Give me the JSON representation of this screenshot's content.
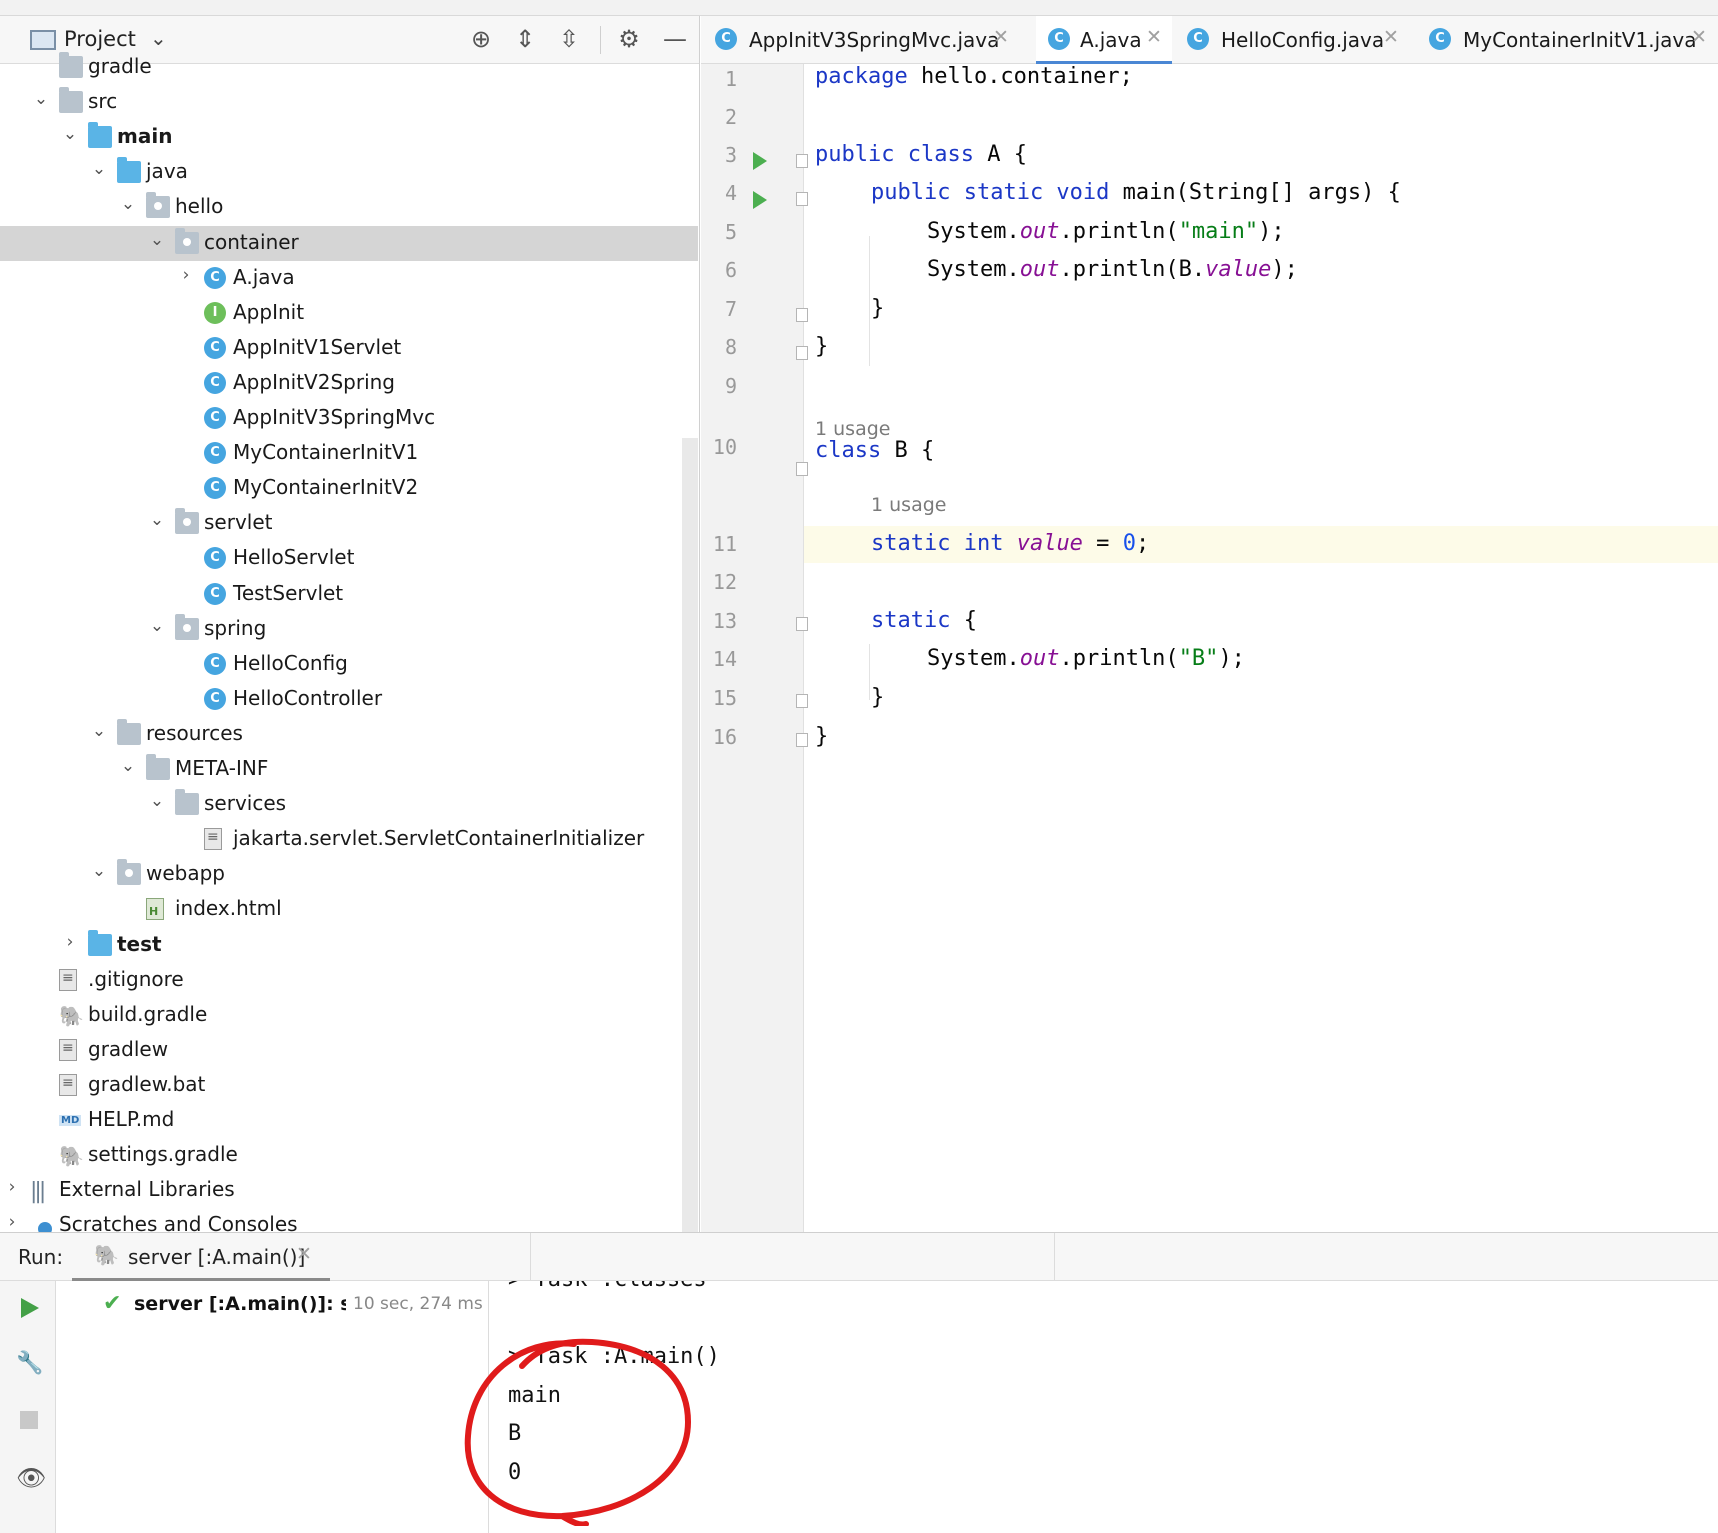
{
  "project_panel": {
    "title": "Project",
    "tree": [
      {
        "label": "gradle",
        "depth": 1,
        "toggle": "",
        "icon": "folder-icon"
      },
      {
        "label": "src",
        "depth": 1,
        "toggle": "expanded",
        "icon": "folder-icon"
      },
      {
        "label": "main",
        "depth": 2,
        "toggle": "expanded",
        "icon": "source-root-folder-icon",
        "bold": true
      },
      {
        "label": "java",
        "depth": 3,
        "toggle": "expanded",
        "icon": "java-source-folder-icon"
      },
      {
        "label": "hello",
        "depth": 4,
        "toggle": "expanded",
        "icon": "package-icon"
      },
      {
        "label": "container",
        "depth": 5,
        "toggle": "expanded",
        "icon": "package-icon",
        "selected": true
      },
      {
        "label": "A.java",
        "depth": 6,
        "toggle": "collapsed",
        "icon": "runnable-class-icon"
      },
      {
        "label": "AppInit",
        "depth": 6,
        "toggle": "",
        "icon": "interface-icon"
      },
      {
        "label": "AppInitV1Servlet",
        "depth": 6,
        "toggle": "",
        "icon": "class-icon"
      },
      {
        "label": "AppInitV2Spring",
        "depth": 6,
        "toggle": "",
        "icon": "class-icon"
      },
      {
        "label": "AppInitV3SpringMvc",
        "depth": 6,
        "toggle": "",
        "icon": "class-icon"
      },
      {
        "label": "MyContainerInitV1",
        "depth": 6,
        "toggle": "",
        "icon": "class-icon"
      },
      {
        "label": "MyContainerInitV2",
        "depth": 6,
        "toggle": "",
        "icon": "class-icon"
      },
      {
        "label": "servlet",
        "depth": 5,
        "toggle": "expanded",
        "icon": "package-icon"
      },
      {
        "label": "HelloServlet",
        "depth": 6,
        "toggle": "",
        "icon": "class-icon"
      },
      {
        "label": "TestServlet",
        "depth": 6,
        "toggle": "",
        "icon": "class-icon"
      },
      {
        "label": "spring",
        "depth": 5,
        "toggle": "expanded",
        "icon": "package-icon"
      },
      {
        "label": "HelloConfig",
        "depth": 6,
        "toggle": "",
        "icon": "class-icon"
      },
      {
        "label": "HelloController",
        "depth": 6,
        "toggle": "",
        "icon": "class-icon"
      },
      {
        "label": "resources",
        "depth": 3,
        "toggle": "expanded",
        "icon": "resources-folder-icon"
      },
      {
        "label": "META-INF",
        "depth": 4,
        "toggle": "expanded",
        "icon": "folder-icon"
      },
      {
        "label": "services",
        "depth": 5,
        "toggle": "expanded",
        "icon": "folder-icon"
      },
      {
        "label": "jakarta.servlet.ServletContainerInitializer",
        "depth": 6,
        "toggle": "",
        "icon": "text-file-icon"
      },
      {
        "label": "webapp",
        "depth": 3,
        "toggle": "expanded",
        "icon": "web-folder-icon"
      },
      {
        "label": "index.html",
        "depth": 4,
        "toggle": "",
        "icon": "html-file-icon"
      },
      {
        "label": "test",
        "depth": 2,
        "toggle": "collapsed",
        "icon": "source-root-folder-icon",
        "bold": true
      },
      {
        "label": ".gitignore",
        "depth": 1,
        "toggle": "",
        "icon": "ignore-file-icon"
      },
      {
        "label": "build.gradle",
        "depth": 1,
        "toggle": "",
        "icon": "gradle-icon"
      },
      {
        "label": "gradlew",
        "depth": 1,
        "toggle": "",
        "icon": "shell-script-icon"
      },
      {
        "label": "gradlew.bat",
        "depth": 1,
        "toggle": "",
        "icon": "text-file-icon"
      },
      {
        "label": "HELP.md",
        "depth": 1,
        "toggle": "",
        "icon": "markdown-file-icon"
      },
      {
        "label": "settings.gradle",
        "depth": 1,
        "toggle": "",
        "icon": "gradle-icon"
      },
      {
        "label": "External Libraries",
        "depth": 0,
        "toggle": "collapsed",
        "icon": "libraries-icon"
      },
      {
        "label": "Scratches and Consoles",
        "depth": 0,
        "toggle": "collapsed",
        "icon": "scratches-icon"
      }
    ]
  },
  "editor_tabs": [
    {
      "label": "AppInitV3SpringMvc.java",
      "active": false
    },
    {
      "label": "A.java",
      "active": true
    },
    {
      "label": "HelloConfig.java",
      "active": false
    },
    {
      "label": "MyContainerInitV1.java",
      "active": false
    }
  ],
  "editor": {
    "line_numbers": [
      "1",
      "2",
      "3",
      "4",
      "5",
      "6",
      "7",
      "8",
      "9",
      "10",
      "11",
      "12",
      "13",
      "14",
      "15",
      "16"
    ],
    "usage_hint": "1 usage",
    "code": {
      "l1_kw": "package",
      "l1_rest": " hello.container;",
      "l3_kw": "public class",
      "l3_rest": " A {",
      "l4_kw": "public static void",
      "l4_rest": " main(String[] args) {",
      "l5_a": "System.",
      "l5_field": "out",
      "l5_b": ".println(",
      "l5_str": "\"main\"",
      "l5_c": ");",
      "l6_a": "System.",
      "l6_field": "out",
      "l6_b": ".println(B.",
      "l6_field2": "value",
      "l6_c": ");",
      "l7": "}",
      "l8": "}",
      "l10_kw": "class",
      "l10_rest": " B {",
      "l11_kw": "static int",
      "l11_field": "value",
      "l11_eq": " = ",
      "l11_num": "0",
      "l11_end": ";",
      "l13_kw": "static",
      "l13_rest": " {",
      "l14_a": "System.",
      "l14_field": "out",
      "l14_b": ".println(",
      "l14_str": "\"B\"",
      "l14_c": ");",
      "l15": "}",
      "l16": "}"
    }
  },
  "run_panel": {
    "title": "Run:",
    "tab_label": "server [:A.main()]",
    "item_label": "server [:A.main()]: suc",
    "item_time": "10 sec, 274 ms",
    "console_lines": [
      "> Task :classes",
      "",
      "> Task :A.main()",
      "main",
      "B",
      "0"
    ]
  },
  "colors": {
    "keyword": "#1b37c6",
    "string": "#067d17",
    "field": "#871094",
    "number": "#1750eb",
    "accent": "#4a87d4",
    "annotation": "#e01b1b"
  }
}
